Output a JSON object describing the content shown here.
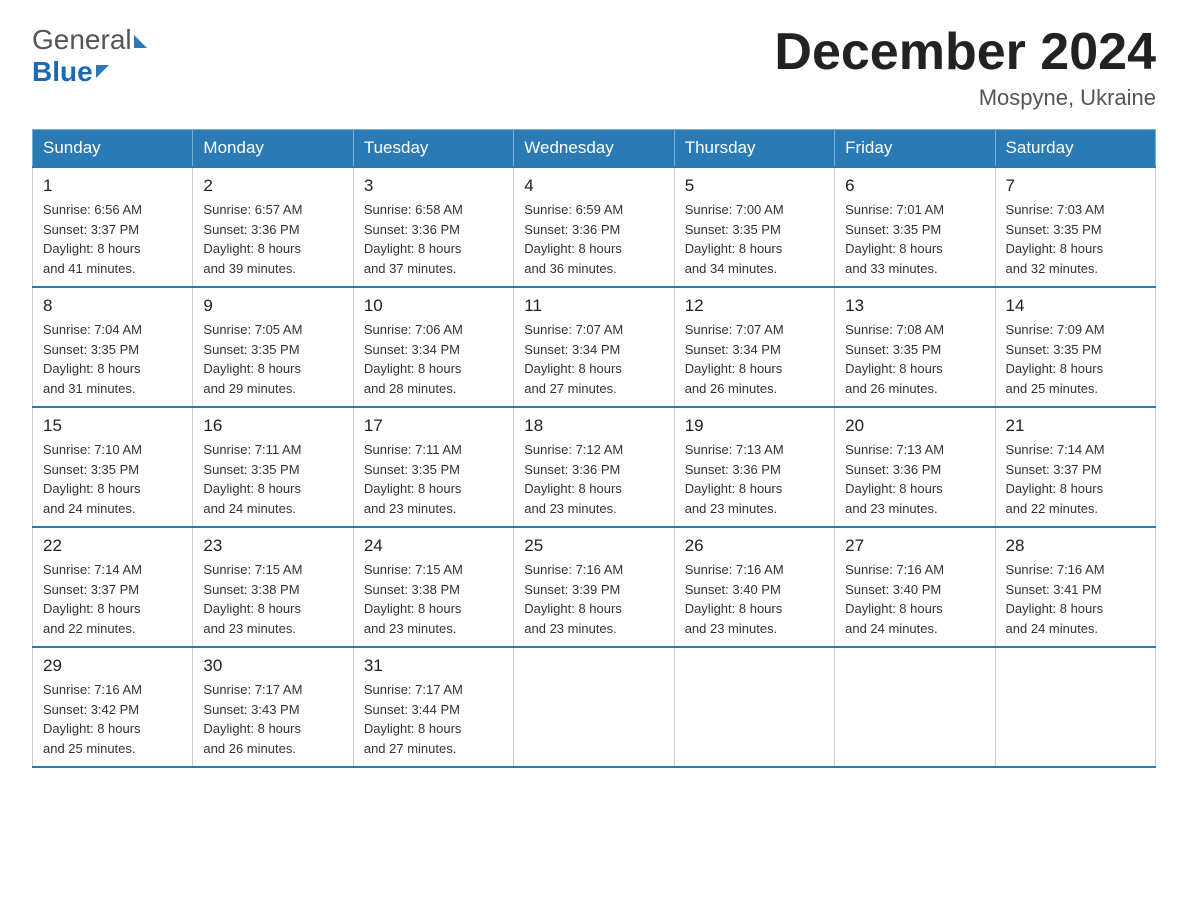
{
  "header": {
    "logo_general": "General",
    "logo_blue": "Blue",
    "month_title": "December 2024",
    "location": "Mospyne, Ukraine"
  },
  "weekdays": [
    "Sunday",
    "Monday",
    "Tuesday",
    "Wednesday",
    "Thursday",
    "Friday",
    "Saturday"
  ],
  "weeks": [
    [
      {
        "day": "1",
        "sunrise": "Sunrise: 6:56 AM",
        "sunset": "Sunset: 3:37 PM",
        "daylight": "Daylight: 8 hours",
        "daylight2": "and 41 minutes."
      },
      {
        "day": "2",
        "sunrise": "Sunrise: 6:57 AM",
        "sunset": "Sunset: 3:36 PM",
        "daylight": "Daylight: 8 hours",
        "daylight2": "and 39 minutes."
      },
      {
        "day": "3",
        "sunrise": "Sunrise: 6:58 AM",
        "sunset": "Sunset: 3:36 PM",
        "daylight": "Daylight: 8 hours",
        "daylight2": "and 37 minutes."
      },
      {
        "day": "4",
        "sunrise": "Sunrise: 6:59 AM",
        "sunset": "Sunset: 3:36 PM",
        "daylight": "Daylight: 8 hours",
        "daylight2": "and 36 minutes."
      },
      {
        "day": "5",
        "sunrise": "Sunrise: 7:00 AM",
        "sunset": "Sunset: 3:35 PM",
        "daylight": "Daylight: 8 hours",
        "daylight2": "and 34 minutes."
      },
      {
        "day": "6",
        "sunrise": "Sunrise: 7:01 AM",
        "sunset": "Sunset: 3:35 PM",
        "daylight": "Daylight: 8 hours",
        "daylight2": "and 33 minutes."
      },
      {
        "day": "7",
        "sunrise": "Sunrise: 7:03 AM",
        "sunset": "Sunset: 3:35 PM",
        "daylight": "Daylight: 8 hours",
        "daylight2": "and 32 minutes."
      }
    ],
    [
      {
        "day": "8",
        "sunrise": "Sunrise: 7:04 AM",
        "sunset": "Sunset: 3:35 PM",
        "daylight": "Daylight: 8 hours",
        "daylight2": "and 31 minutes."
      },
      {
        "day": "9",
        "sunrise": "Sunrise: 7:05 AM",
        "sunset": "Sunset: 3:35 PM",
        "daylight": "Daylight: 8 hours",
        "daylight2": "and 29 minutes."
      },
      {
        "day": "10",
        "sunrise": "Sunrise: 7:06 AM",
        "sunset": "Sunset: 3:34 PM",
        "daylight": "Daylight: 8 hours",
        "daylight2": "and 28 minutes."
      },
      {
        "day": "11",
        "sunrise": "Sunrise: 7:07 AM",
        "sunset": "Sunset: 3:34 PM",
        "daylight": "Daylight: 8 hours",
        "daylight2": "and 27 minutes."
      },
      {
        "day": "12",
        "sunrise": "Sunrise: 7:07 AM",
        "sunset": "Sunset: 3:34 PM",
        "daylight": "Daylight: 8 hours",
        "daylight2": "and 26 minutes."
      },
      {
        "day": "13",
        "sunrise": "Sunrise: 7:08 AM",
        "sunset": "Sunset: 3:35 PM",
        "daylight": "Daylight: 8 hours",
        "daylight2": "and 26 minutes."
      },
      {
        "day": "14",
        "sunrise": "Sunrise: 7:09 AM",
        "sunset": "Sunset: 3:35 PM",
        "daylight": "Daylight: 8 hours",
        "daylight2": "and 25 minutes."
      }
    ],
    [
      {
        "day": "15",
        "sunrise": "Sunrise: 7:10 AM",
        "sunset": "Sunset: 3:35 PM",
        "daylight": "Daylight: 8 hours",
        "daylight2": "and 24 minutes."
      },
      {
        "day": "16",
        "sunrise": "Sunrise: 7:11 AM",
        "sunset": "Sunset: 3:35 PM",
        "daylight": "Daylight: 8 hours",
        "daylight2": "and 24 minutes."
      },
      {
        "day": "17",
        "sunrise": "Sunrise: 7:11 AM",
        "sunset": "Sunset: 3:35 PM",
        "daylight": "Daylight: 8 hours",
        "daylight2": "and 23 minutes."
      },
      {
        "day": "18",
        "sunrise": "Sunrise: 7:12 AM",
        "sunset": "Sunset: 3:36 PM",
        "daylight": "Daylight: 8 hours",
        "daylight2": "and 23 minutes."
      },
      {
        "day": "19",
        "sunrise": "Sunrise: 7:13 AM",
        "sunset": "Sunset: 3:36 PM",
        "daylight": "Daylight: 8 hours",
        "daylight2": "and 23 minutes."
      },
      {
        "day": "20",
        "sunrise": "Sunrise: 7:13 AM",
        "sunset": "Sunset: 3:36 PM",
        "daylight": "Daylight: 8 hours",
        "daylight2": "and 23 minutes."
      },
      {
        "day": "21",
        "sunrise": "Sunrise: 7:14 AM",
        "sunset": "Sunset: 3:37 PM",
        "daylight": "Daylight: 8 hours",
        "daylight2": "and 22 minutes."
      }
    ],
    [
      {
        "day": "22",
        "sunrise": "Sunrise: 7:14 AM",
        "sunset": "Sunset: 3:37 PM",
        "daylight": "Daylight: 8 hours",
        "daylight2": "and 22 minutes."
      },
      {
        "day": "23",
        "sunrise": "Sunrise: 7:15 AM",
        "sunset": "Sunset: 3:38 PM",
        "daylight": "Daylight: 8 hours",
        "daylight2": "and 23 minutes."
      },
      {
        "day": "24",
        "sunrise": "Sunrise: 7:15 AM",
        "sunset": "Sunset: 3:38 PM",
        "daylight": "Daylight: 8 hours",
        "daylight2": "and 23 minutes."
      },
      {
        "day": "25",
        "sunrise": "Sunrise: 7:16 AM",
        "sunset": "Sunset: 3:39 PM",
        "daylight": "Daylight: 8 hours",
        "daylight2": "and 23 minutes."
      },
      {
        "day": "26",
        "sunrise": "Sunrise: 7:16 AM",
        "sunset": "Sunset: 3:40 PM",
        "daylight": "Daylight: 8 hours",
        "daylight2": "and 23 minutes."
      },
      {
        "day": "27",
        "sunrise": "Sunrise: 7:16 AM",
        "sunset": "Sunset: 3:40 PM",
        "daylight": "Daylight: 8 hours",
        "daylight2": "and 24 minutes."
      },
      {
        "day": "28",
        "sunrise": "Sunrise: 7:16 AM",
        "sunset": "Sunset: 3:41 PM",
        "daylight": "Daylight: 8 hours",
        "daylight2": "and 24 minutes."
      }
    ],
    [
      {
        "day": "29",
        "sunrise": "Sunrise: 7:16 AM",
        "sunset": "Sunset: 3:42 PM",
        "daylight": "Daylight: 8 hours",
        "daylight2": "and 25 minutes."
      },
      {
        "day": "30",
        "sunrise": "Sunrise: 7:17 AM",
        "sunset": "Sunset: 3:43 PM",
        "daylight": "Daylight: 8 hours",
        "daylight2": "and 26 minutes."
      },
      {
        "day": "31",
        "sunrise": "Sunrise: 7:17 AM",
        "sunset": "Sunset: 3:44 PM",
        "daylight": "Daylight: 8 hours",
        "daylight2": "and 27 minutes."
      },
      null,
      null,
      null,
      null
    ]
  ]
}
